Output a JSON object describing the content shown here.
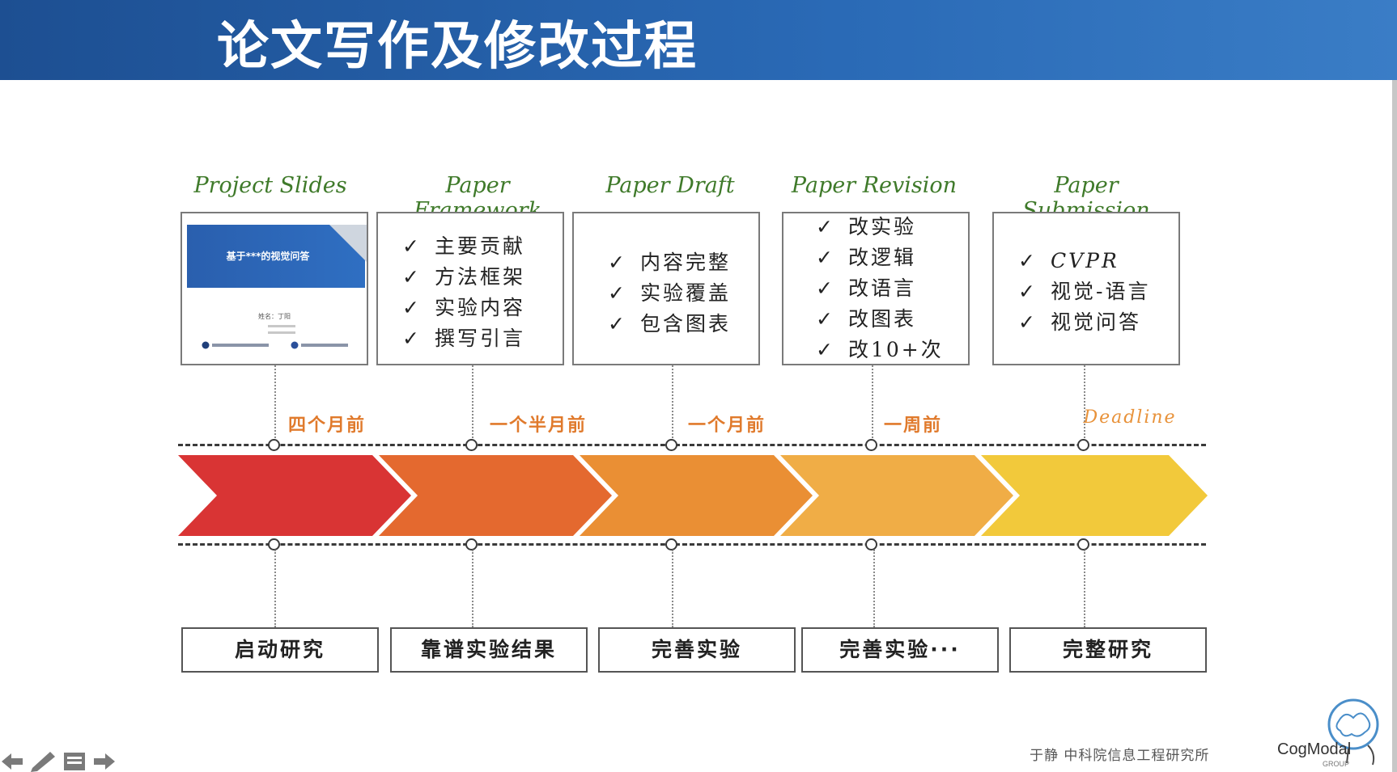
{
  "header": {
    "title": "论文写作及修改过程"
  },
  "stages": [
    {
      "title": "Project Slides",
      "slide": {
        "title": "基于***的视觉问答",
        "name": "姓名：丁阳"
      }
    },
    {
      "title": "Paper Framework",
      "items": [
        "主要贡献",
        "方法框架",
        "实验内容",
        "撰写引言"
      ]
    },
    {
      "title": "Paper Draft",
      "items": [
        "内容完整",
        "实验覆盖",
        "包含图表"
      ]
    },
    {
      "title": "Paper Revision",
      "items": [
        "改实验",
        "改逻辑",
        "改语言",
        "改图表",
        "改10+次"
      ]
    },
    {
      "title": "Paper Submission",
      "items": [
        "CVPR",
        "视觉-语言",
        "视觉问答"
      ]
    }
  ],
  "check_mark": "✓",
  "timeline": [
    "四个月前",
    "一个半月前",
    "一个月前",
    "一周前",
    "Deadline"
  ],
  "bottom": [
    "启动研究",
    "靠谱实验结果",
    "完善实验",
    "完善实验···",
    "完整研究"
  ],
  "arrow_colors": [
    "#d93434",
    "#e4692f",
    "#ea8f34",
    "#f0ad46",
    "#f2c93b"
  ],
  "footer": {
    "affiliation": "于静 中科院信息工程研究所",
    "logo": "CogModal",
    "logo_sub": "GROUP"
  }
}
